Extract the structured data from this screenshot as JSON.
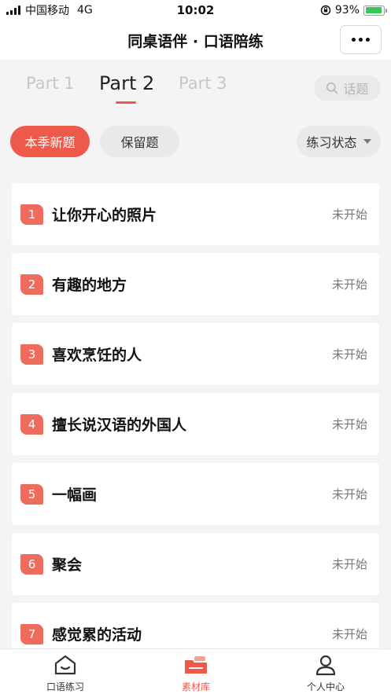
{
  "status_bar": {
    "carrier": "中国移动",
    "network": "4G",
    "time": "10:02",
    "battery_percent": "93%",
    "battery_level": 0.93
  },
  "nav": {
    "title": "同桌语伴 · 口语陪练",
    "more_icon": "more-dots-icon"
  },
  "part_tabs": [
    {
      "label": "Part 1",
      "active": false
    },
    {
      "label": "Part 2",
      "active": true
    },
    {
      "label": "Part 3",
      "active": false
    }
  ],
  "search": {
    "placeholder": "话题",
    "icon": "search-icon"
  },
  "filters": {
    "new_label": "本季新题",
    "retained_label": "保留题",
    "status_label": "练习状态"
  },
  "topics": [
    {
      "number": "1",
      "title": "让你开心的照片",
      "status": "未开始"
    },
    {
      "number": "2",
      "title": "有趣的地方",
      "status": "未开始"
    },
    {
      "number": "3",
      "title": "喜欢烹饪的人",
      "status": "未开始"
    },
    {
      "number": "4",
      "title": "擅长说汉语的外国人",
      "status": "未开始"
    },
    {
      "number": "5",
      "title": "一幅画",
      "status": "未开始"
    },
    {
      "number": "6",
      "title": "聚会",
      "status": "未开始"
    },
    {
      "number": "7",
      "title": "感觉累的活动",
      "status": "未开始"
    }
  ],
  "tab_bar": [
    {
      "label": "口语练习",
      "icon": "home-icon",
      "active": false
    },
    {
      "label": "素材库",
      "icon": "folder-icon",
      "active": true
    },
    {
      "label": "个人中心",
      "icon": "person-icon",
      "active": false
    }
  ],
  "colors": {
    "accent": "#ee5a4a",
    "background": "#f4f4f4",
    "inactive_text": "#c7c7c7"
  }
}
